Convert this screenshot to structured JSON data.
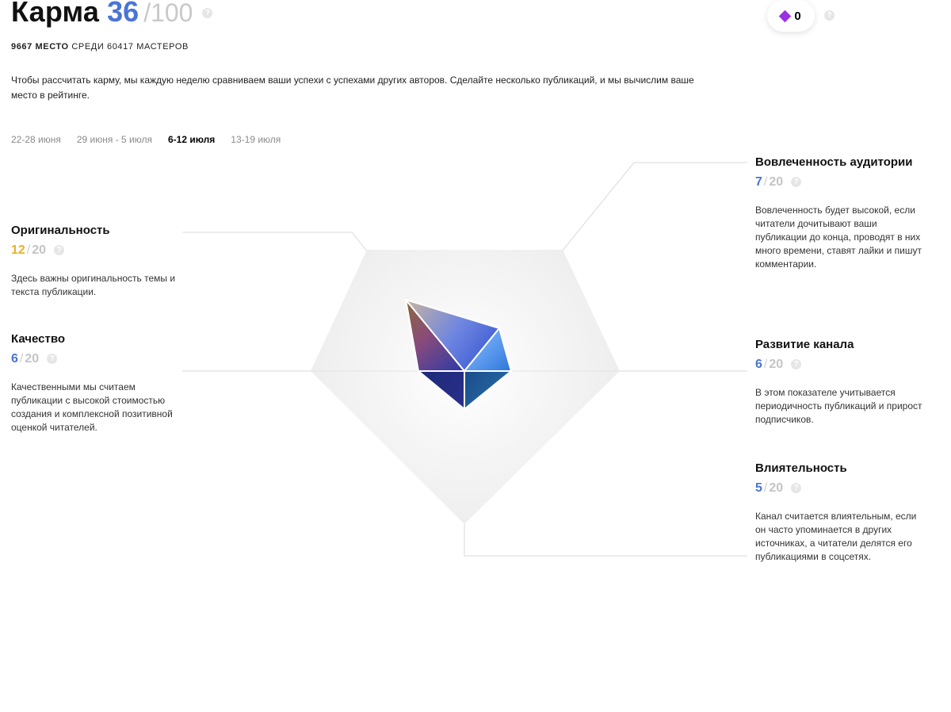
{
  "header": {
    "title": "Карма",
    "score": "36",
    "max": "/100",
    "help": "?"
  },
  "rank": {
    "place": "9667 МЕСТО",
    "rest": "СРЕДИ 60417 МАСТЕРОВ"
  },
  "description": "Чтобы рассчитать карму, мы каждую неделю сравниваем ваши успехи с успехами других авторов. Сделайте несколько публикаций, и мы вычислим ваше место в рейтинге.",
  "weeks": [
    {
      "label": "22-28 июня",
      "active": false
    },
    {
      "label": "29 июня - 5 июля",
      "active": false
    },
    {
      "label": "6-12 июля",
      "active": true
    },
    {
      "label": "13-19 июля",
      "active": false
    }
  ],
  "badge": {
    "icon": "diamond-icon",
    "count": "0"
  },
  "metrics": {
    "originality": {
      "name": "Оригинальность",
      "value": "12",
      "sep": "/",
      "max": "20",
      "color": "#e8b12b",
      "text": "Здесь важны оригинальность темы и текста публикации."
    },
    "quality": {
      "name": "Качество",
      "value": "6",
      "sep": "/",
      "max": "20",
      "color": "#4a74d6",
      "text": "Качественными мы считаем публикации с высокой стоимостью создания и комплексной позитивной оценкой читателей."
    },
    "engagement": {
      "name": "Вовлеченность аудитории",
      "value": "7",
      "sep": "/",
      "max": "20",
      "color": "#4a74d6",
      "text": "Вовлеченность будет высокой, если читатели дочитывают ваши публикации до конца, проводят в них много времени, ставят лайки и пишут комментарии."
    },
    "growth": {
      "name": "Развитие канала",
      "value": "6",
      "sep": "/",
      "max": "20",
      "color": "#4a74d6",
      "text": "В этом показателе учитывается периодичность публикаций и прирост подписчиков."
    },
    "influence": {
      "name": "Влиятельность",
      "value": "5",
      "sep": "/",
      "max": "20",
      "color": "#4a74d6",
      "text": "Канал считается влиятельным, если он часто упоминается в других источниках, а читатели делятся его публикациями в соцсетях."
    }
  }
}
